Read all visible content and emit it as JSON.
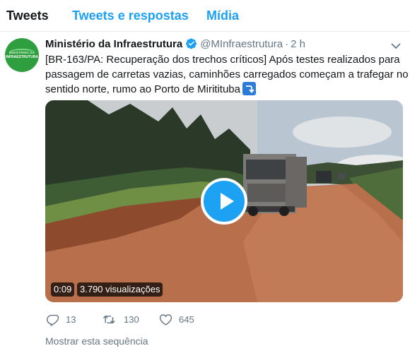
{
  "tabs": [
    {
      "label": "Tweets",
      "active": true
    },
    {
      "label": "Tweets e respostas",
      "active": false
    },
    {
      "label": "Mídia",
      "active": false
    }
  ],
  "tweet": {
    "avatar": {
      "line1": "MINISTÉRIO DA",
      "line2": "INFRAESTRUTURA",
      "color": "#2f9e3e"
    },
    "author_name": "Ministério da Infraestrutura",
    "verified": true,
    "handle": "@MInfraestrutura",
    "separator": "·",
    "time": "2 h",
    "text_lines": [
      "[BR-163/PA: Recuperação dos trechos críticos] Após testes realizados para",
      "passagem de carretas vazias, caminhões carregados começam a trafegar no",
      "sentido norte, rumo ao Porto de Miritituba"
    ],
    "emoji": "right-arrow-curving-down-icon",
    "video": {
      "duration": "0:09",
      "views": "3.790 visualizações"
    },
    "actions": {
      "replies": "13",
      "retweets": "130",
      "likes": "645"
    },
    "show_thread": "Mostrar esta sequência"
  },
  "colors": {
    "accent": "#1da1f2",
    "text_primary": "#14171a",
    "text_secondary": "#657786",
    "divider": "#e6ecf0"
  }
}
